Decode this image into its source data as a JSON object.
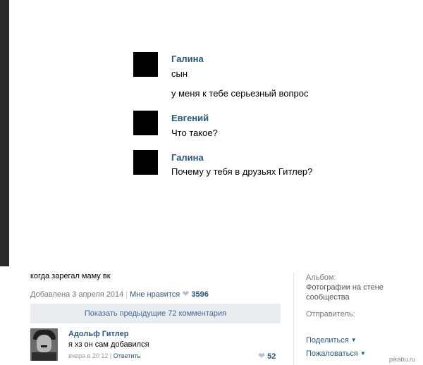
{
  "dialog": {
    "messages": [
      {
        "author": "Галина",
        "lines": [
          "сын",
          "у меня к тебе серьезный вопрос"
        ]
      },
      {
        "author": "Евгений",
        "lines": [
          "Что такое?"
        ]
      },
      {
        "author": "Галина",
        "lines": [
          "Почему у тебя в друзьях Гитлер?"
        ]
      }
    ]
  },
  "post": {
    "caption": "когда зарегал маму вк",
    "date": "Добавлена 3 апреля 2014",
    "separator": "|",
    "like_label": "Мне нравится",
    "likes": "3596",
    "show_previous": "Показать предыдущие 72 комментария"
  },
  "comment": {
    "author": "Адольф Гитлер",
    "text": "я хз он сам добавился",
    "time": "вчера в 20:12",
    "separator": "|",
    "reply_label": "Ответить",
    "likes": "52"
  },
  "sidebar": {
    "album_label": "Альбом:",
    "album_name_line1": "Фотографии на стене",
    "album_name_line2": "сообщества",
    "sender_label": "Отправитель:",
    "share_label": "Поделиться",
    "report_label": "Пожаловаться"
  },
  "watermark": "pikabu.ru",
  "icons": {
    "like": "heart-icon",
    "dropdown": "caret-down-icon"
  },
  "colors": {
    "link": "#2b587a",
    "button_bg": "#e9edf1",
    "avatar": "#000000"
  }
}
